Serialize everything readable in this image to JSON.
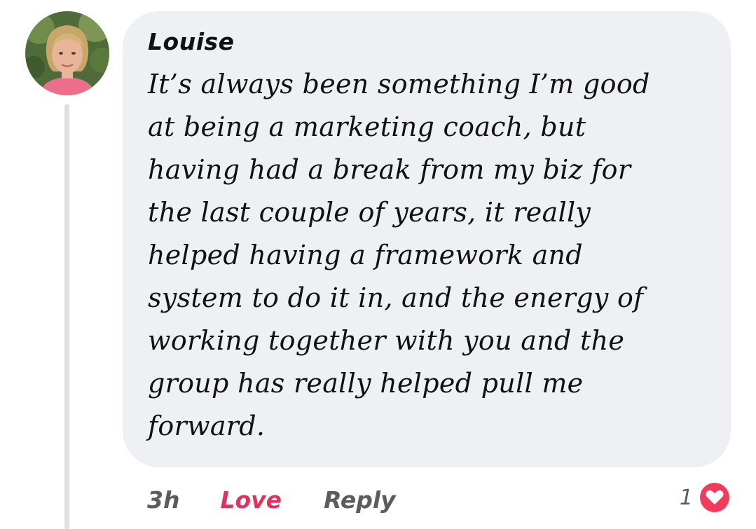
{
  "comment": {
    "author": "Louise",
    "text": "It’s always been something I’m good\nat being a marketing coach, but\nhaving had a break from my biz for\nthe last couple of years, it really\nhelped having a framework and\nsystem to do it in, and the energy of\nworking together with you and the\ngroup has really helped pull me\nforward.",
    "timestamp": "3h",
    "love_label": "Love",
    "reply_label": "Reply",
    "reaction_count": "1",
    "reaction_icon": "heart-icon"
  },
  "colors": {
    "bubble": "#eff0f4",
    "love": "#e0325a",
    "muted": "#5b5b60",
    "thread_line": "#dfe0e4"
  }
}
